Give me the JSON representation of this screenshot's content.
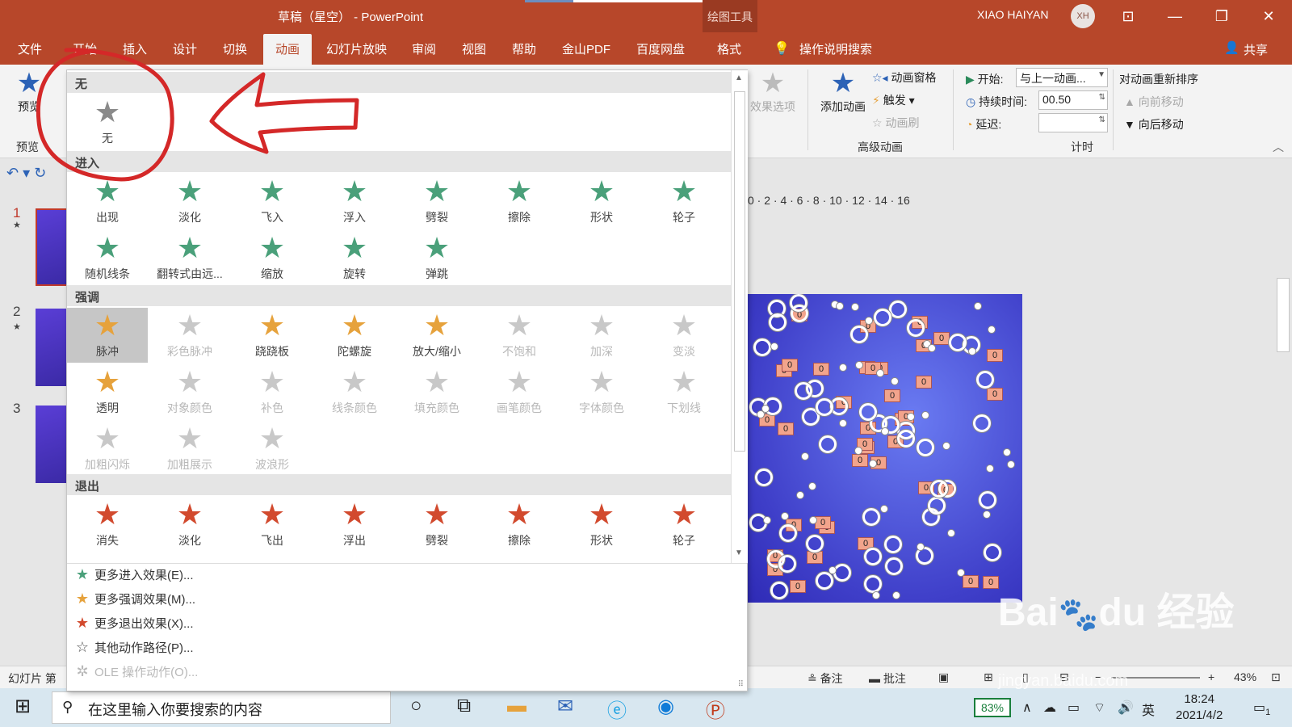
{
  "titlebar": {
    "title": "草稿（星空） - PowerPoint",
    "contextual_tab_group": "绘图工具",
    "user_name": "XIAO HAIYAN",
    "avatar_initials": "XH",
    "colors": {
      "accent": "#b7472a"
    }
  },
  "tabs": {
    "items": [
      {
        "label": "文件"
      },
      {
        "label": "开始"
      },
      {
        "label": "插入"
      },
      {
        "label": "设计"
      },
      {
        "label": "切换"
      },
      {
        "label": "动画"
      },
      {
        "label": "幻灯片放映"
      },
      {
        "label": "审阅"
      },
      {
        "label": "视图"
      },
      {
        "label": "帮助"
      },
      {
        "label": "金山PDF"
      },
      {
        "label": "百度网盘"
      },
      {
        "label": "格式"
      }
    ],
    "active": "动画",
    "tell_me": "操作说明搜索",
    "share": "共享"
  },
  "ribbon": {
    "preview_label": "预览",
    "preview_group": "预览",
    "effect_options": "效果选项",
    "add_animation": "添加动画",
    "animation_pane": "动画窗格",
    "trigger": "触发",
    "animation_painter": "动画刷",
    "advanced_group": "高级动画",
    "start_label": "开始:",
    "start_value": "与上一动画...",
    "duration_label": "持续时间:",
    "duration_value": "00.50",
    "delay_label": "延迟:",
    "delay_value": "",
    "timing_group": "计时",
    "reorder_title": "对动画重新排序",
    "move_earlier": "向前移动",
    "move_later": "向后移动"
  },
  "gallery": {
    "sections": {
      "none": "无",
      "entrance": "进入",
      "emphasis": "强调",
      "exit": "退出"
    },
    "none_items": [
      {
        "label": "无",
        "color": "#8a8a8a"
      }
    ],
    "entrance_items": [
      {
        "label": "出现"
      },
      {
        "label": "淡化"
      },
      {
        "label": "飞入"
      },
      {
        "label": "浮入"
      },
      {
        "label": "劈裂"
      },
      {
        "label": "擦除"
      },
      {
        "label": "形状"
      },
      {
        "label": "轮子"
      },
      {
        "label": "随机线条"
      },
      {
        "label": "翻转式由远..."
      },
      {
        "label": "缩放"
      },
      {
        "label": "旋转"
      },
      {
        "label": "弹跳"
      }
    ],
    "emphasis_items": [
      {
        "label": "脉冲",
        "enabled": true,
        "selected": true
      },
      {
        "label": "彩色脉冲",
        "enabled": false
      },
      {
        "label": "跷跷板",
        "enabled": true
      },
      {
        "label": "陀螺旋",
        "enabled": true
      },
      {
        "label": "放大/缩小",
        "enabled": true
      },
      {
        "label": "不饱和",
        "enabled": false
      },
      {
        "label": "加深",
        "enabled": false
      },
      {
        "label": "变淡",
        "enabled": false
      },
      {
        "label": "透明",
        "enabled": true
      },
      {
        "label": "对象颜色",
        "enabled": false
      },
      {
        "label": "补色",
        "enabled": false
      },
      {
        "label": "线条颜色",
        "enabled": false
      },
      {
        "label": "填充颜色",
        "enabled": false
      },
      {
        "label": "画笔颜色",
        "enabled": false
      },
      {
        "label": "字体颜色",
        "enabled": false
      },
      {
        "label": "下划线",
        "enabled": false
      },
      {
        "label": "加粗闪烁",
        "enabled": false
      },
      {
        "label": "加粗展示",
        "enabled": false
      },
      {
        "label": "波浪形",
        "enabled": false
      }
    ],
    "exit_items": [
      {
        "label": "消失"
      },
      {
        "label": "淡化"
      },
      {
        "label": "飞出"
      },
      {
        "label": "浮出"
      },
      {
        "label": "劈裂"
      },
      {
        "label": "擦除"
      },
      {
        "label": "形状"
      },
      {
        "label": "轮子"
      }
    ],
    "more": [
      {
        "label": "更多进入效果(E)...",
        "icon": "green-star-icon",
        "color": "#4aa07a"
      },
      {
        "label": "更多强调效果(M)...",
        "icon": "gold-star-icon",
        "color": "#e6a23c"
      },
      {
        "label": "更多退出效果(X)...",
        "icon": "red-star-icon",
        "color": "#d24a2e"
      },
      {
        "label": "其他动作路径(P)...",
        "icon": "outline-star-icon",
        "color": "#555555"
      },
      {
        "label": "OLE 操作动作(O)...",
        "icon": "gear-star-icon",
        "color": "#b8b8b8",
        "enabled": false
      }
    ]
  },
  "slides": {
    "numbers": [
      "1",
      "2",
      "3"
    ],
    "ruler_text": "0 · 2 · 4 · 6 · 8 · 10 · 12 · 14 · 16",
    "tag_value": "0"
  },
  "statusbar": {
    "slide_label": "幻灯片 第",
    "notes": "备注",
    "comments": "批注",
    "zoom": "43%"
  },
  "taskbar": {
    "search_placeholder": "在这里输入你要搜索的内容",
    "battery": "83%",
    "ime": "英",
    "time": "18:24",
    "date": "2021/4/2",
    "notification_count": "1"
  },
  "watermark": {
    "logo_text": "Bai du 经验",
    "url": "jingyan.baidu.com"
  }
}
